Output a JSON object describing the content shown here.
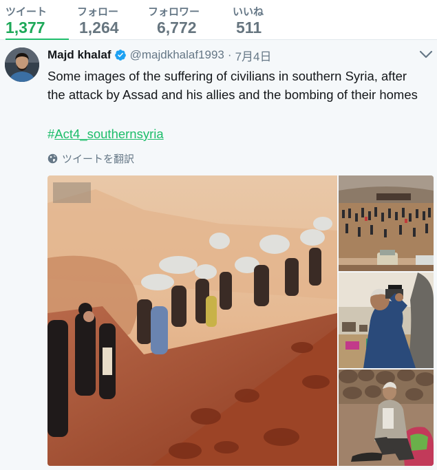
{
  "stats": [
    {
      "label": "ツイート",
      "value": "1,377"
    },
    {
      "label": "フォロー",
      "value": "1,264"
    },
    {
      "label": "フォロワー",
      "value": "6,772"
    },
    {
      "label": "いいね",
      "value": "511"
    }
  ],
  "tweet": {
    "name": "Majd khalaf",
    "handle": "@majdkhalaf1993",
    "separator": "·",
    "date": "7月4日",
    "text": "Some images of the suffering of civilians in southern Syria, after the attack by Assad and his allies and the bombing of their homes",
    "hashtag_symbol": "#",
    "hashtag_text": "Act4_southernsyria",
    "translate_label": "ツイートを翻訳"
  },
  "colors": {
    "accent": "#1dbd6a",
    "verified": "#1da1f2",
    "muted": "#657786"
  },
  "icons": {
    "verified": "verified-badge-icon",
    "caret": "chevron-down-icon",
    "translate": "globe-icon"
  }
}
